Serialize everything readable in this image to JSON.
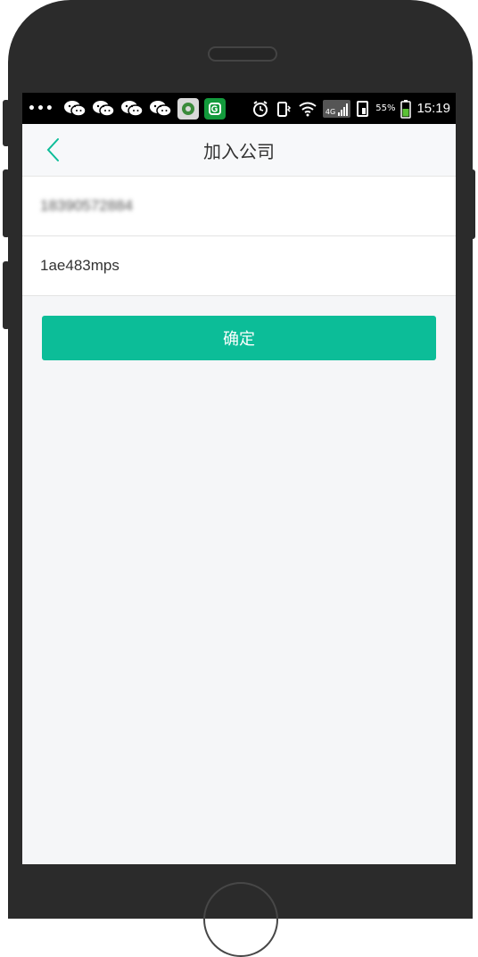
{
  "status_bar": {
    "time": "15:19",
    "battery_percent": "55%",
    "network": "4G",
    "icons": [
      "more-dots-icon",
      "wechat-icon",
      "wechat-icon",
      "wechat-icon",
      "wechat-icon",
      "gear-app-icon",
      "green-app-icon",
      "alarm-icon",
      "vibrate-icon",
      "wifi-icon",
      "signal-icon",
      "sim-icon",
      "battery-icon"
    ]
  },
  "nav": {
    "title": "加入公司",
    "back_icon": "chevron-left-icon"
  },
  "form": {
    "phone_value": "18390572884",
    "code_value": "1ae483mps"
  },
  "confirm_label": "确定",
  "colors": {
    "accent": "#0cbd98",
    "page_bg": "#f5f6f8",
    "phone_frame": "#2b2b2b"
  }
}
